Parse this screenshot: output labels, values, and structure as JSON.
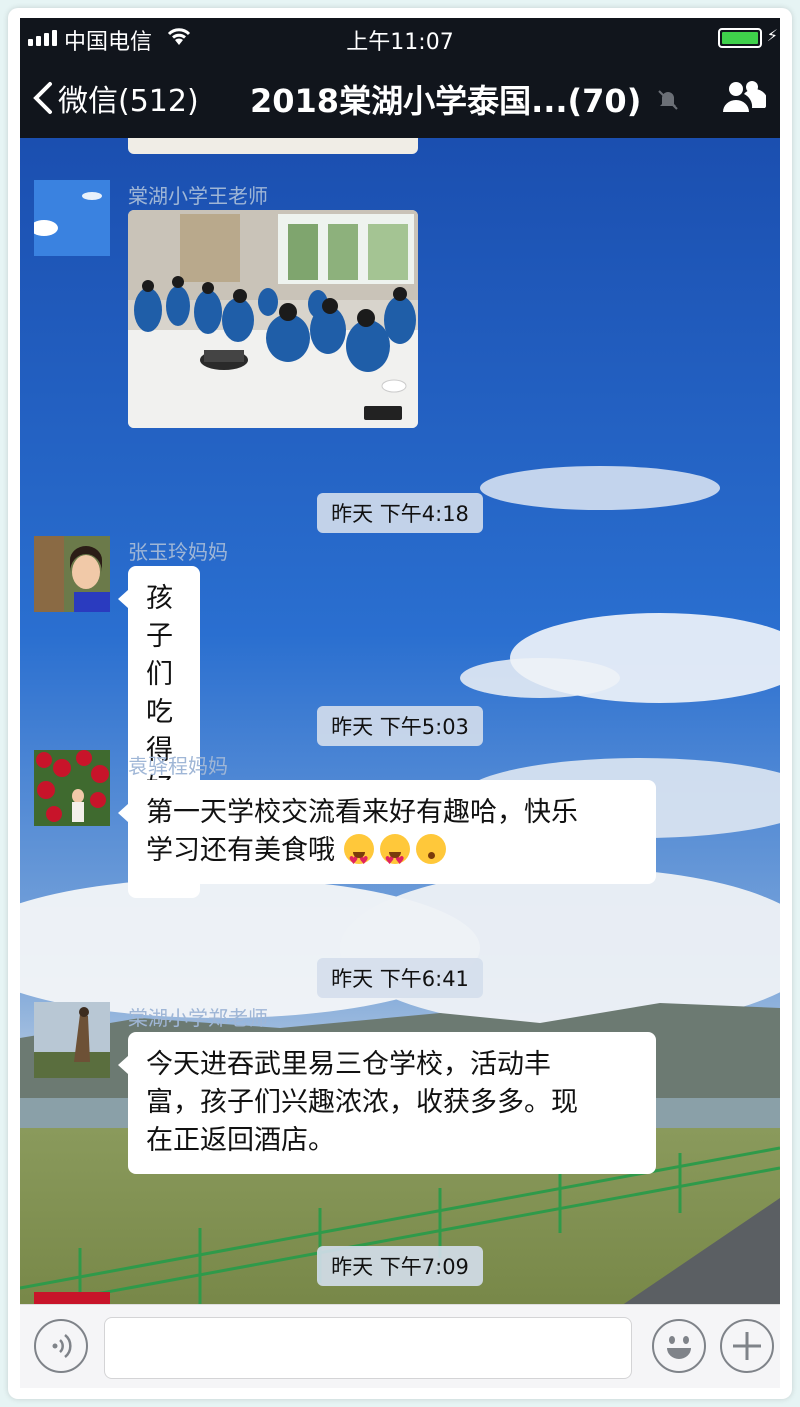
{
  "status_bar": {
    "carrier": "中国电信",
    "time": "上午11:07"
  },
  "nav": {
    "back_label": "微信(512)",
    "title": "2018棠湖小学泰国...(70)"
  },
  "messages": [
    {
      "sender": "棠湖小学王老师",
      "type": "image"
    },
    {
      "timestamp": "昨天 下午4:18"
    },
    {
      "sender": "张玉玲妈妈",
      "type": "text",
      "text": "孩子们吃得好香"
    },
    {
      "timestamp": "昨天 下午5:03"
    },
    {
      "sender": "袁驿程妈妈",
      "type": "text",
      "text_line1": "第一天学校交流看来好有趣哈，快乐",
      "text_line2": "学习还有美食哦"
    },
    {
      "timestamp": "昨天 下午6:41"
    },
    {
      "sender": "棠湖小学郑老师",
      "type": "text",
      "text_line1": "今天进吞武里易三仓学校，活动丰",
      "text_line2": "富，孩子们兴趣浓浓，收获多多。现",
      "text_line3": "在正返回酒店。"
    },
    {
      "timestamp": "昨天 下午7:09"
    }
  ],
  "colors": {
    "nav_bg": "#11151c",
    "sky": "#1f5fc0",
    "bubble": "#ffffff",
    "sender_name": "#9fb6d6",
    "battery": "#3fd04b"
  },
  "icons": [
    "signal-icon",
    "wifi-icon",
    "battery-icon",
    "back-chevron-icon",
    "mute-icon",
    "group-members-icon",
    "voice-icon",
    "emoji-icon",
    "plus-icon"
  ]
}
